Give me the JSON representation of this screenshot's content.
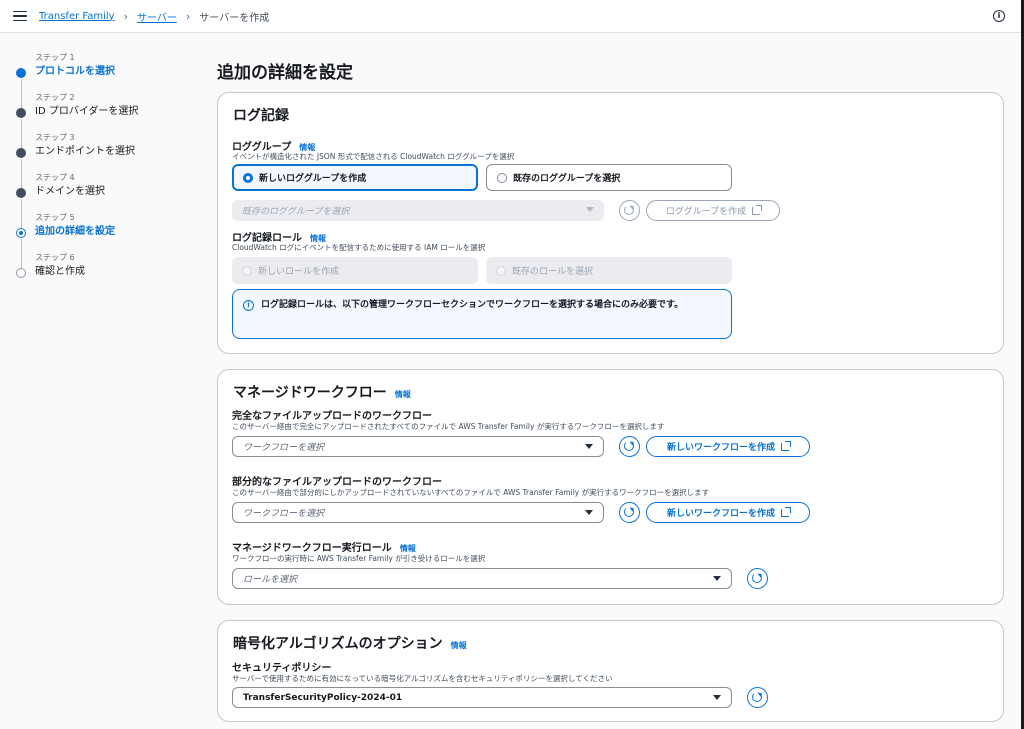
{
  "breadcrumb": {
    "root": "Transfer Family",
    "servers": "サーバー",
    "current": "サーバーを作成"
  },
  "steps": [
    {
      "label": "ステップ 1",
      "name": "プロトコルを選択"
    },
    {
      "label": "ステップ 2",
      "name": "ID プロバイダーを選択"
    },
    {
      "label": "ステップ 3",
      "name": "エンドポイントを選択"
    },
    {
      "label": "ステップ 4",
      "name": "ドメインを選択"
    },
    {
      "label": "ステップ 5",
      "name": "追加の詳細を設定"
    },
    {
      "label": "ステップ 6",
      "name": "確認と作成"
    }
  ],
  "page_title": "追加の詳細を設定",
  "info_link": "情報",
  "logging": {
    "title": "ログ記録",
    "log_group_label": "ロググループ",
    "log_group_desc": "イベントが構造化された JSON 形式で配信される CloudWatch ロググループを選択",
    "option_new": "新しいロググループを作成",
    "option_existing": "既存のロググループを選択",
    "existing_placeholder": "既存のロググループを選択",
    "create_button": "ロググループを作成",
    "role_label": "ログ記録ロール",
    "role_desc": "CloudWatch ログにイベントを配信するために使用する IAM ロールを選択",
    "role_new": "新しいロールを作成",
    "role_existing": "既存のロールを選択",
    "alert": "ログ記録ロールは、以下の管理ワークフローセクションでワークフローを選択する場合にのみ必要です。"
  },
  "workflow": {
    "title": "マネージドワークフロー",
    "full_label": "完全なファイルアップロードのワークフロー",
    "full_desc": "このサーバー経由で完全にアップロードされたすべてのファイルで AWS Transfer Family が実行するワークフローを選択します",
    "partial_label": "部分的なファイルアップロードのワークフロー",
    "partial_desc": "このサーバー経由で部分的にしかアップロードされていないすべてのファイルで AWS Transfer Family が実行するワークフローを選択します",
    "workflow_placeholder": "ワークフローを選択",
    "new_workflow_button": "新しいワークフローを作成",
    "role_label": "マネージドワークフロー実行ロール",
    "role_desc": "ワークフローの実行時に AWS Transfer Family が引き受けるロールを選択",
    "role_placeholder": "ロールを選択"
  },
  "crypto": {
    "title": "暗号化アルゴリズムのオプション",
    "policy_label": "セキュリティポリシー",
    "policy_desc": "サーバーで使用するために有効になっている暗号化アルゴリズムを含むセキュリティポリシーを選択してください",
    "policy_value": "TransferSecurityPolicy-2024-01"
  },
  "colors": {
    "accent": "#0972d3",
    "text": "#16191f",
    "border": "#c6c6cd"
  }
}
